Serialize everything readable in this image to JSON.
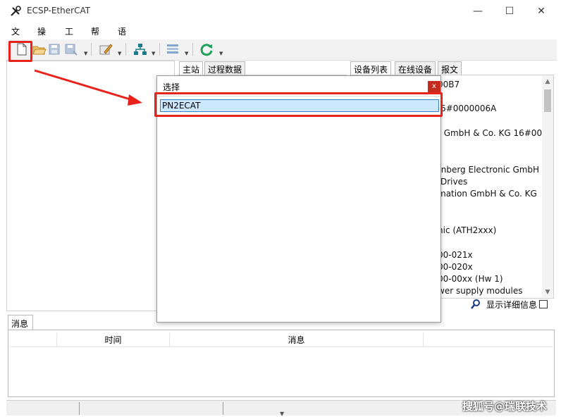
{
  "window": {
    "title": "ECSP-EtherCAT",
    "min_glyph": "—",
    "max_glyph": "☐",
    "close_glyph": "✕"
  },
  "menu": {
    "items": [
      "文件",
      "操作",
      "工具",
      "帮助",
      "语言"
    ]
  },
  "toolbar": {
    "buttons": [
      "new-file-icon",
      "open-folder-icon",
      "save-icon",
      "save-as-icon",
      "edit-settings-icon",
      "network-icon",
      "config-list-icon",
      "refresh-icon"
    ]
  },
  "middle_tabs": [
    "主站",
    "过程数据"
  ],
  "right_tabs": [
    "设备列表",
    "在线设备",
    "报文"
  ],
  "device_list_lines": [
    "00B7",
    "6#0000006A",
    "r GmbH & Co. KG    16#00",
    "rnberg Electronic GmbH",
    "Drives",
    "mation GmbH & Co. KG",
    "nic (ATH2xxx)",
    "00-021x",
    "00-020x",
    "00-00xx (Hw 1)",
    "wer supply modules"
  ],
  "details": {
    "label": "显示详细信息",
    "checked": false
  },
  "messages": {
    "tab_label": "消息",
    "columns": [
      "",
      "时间",
      "消息",
      ""
    ]
  },
  "dialog": {
    "title": "选择",
    "close_label": "x",
    "items": [
      "PN2ECAT"
    ],
    "selected_index": 0
  },
  "watermark": "搜狐号@瑞联技术",
  "colors": {
    "annotation_red": "#e8231c",
    "selection_blue": "#cce8ff",
    "dialog_close_red": "#c42b1c"
  }
}
